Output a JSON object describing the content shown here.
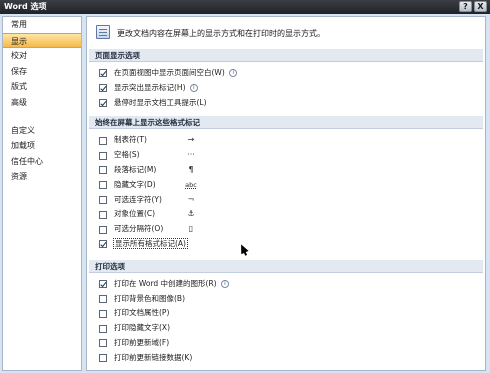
{
  "window": {
    "title": "Word 选项",
    "help_label": "?",
    "close_label": "X"
  },
  "sidebar": {
    "items": [
      {
        "label": "常用"
      },
      {
        "label": "显示",
        "active": true
      },
      {
        "label": "校对"
      },
      {
        "label": "保存"
      },
      {
        "label": "版式"
      },
      {
        "label": "高级"
      },
      {
        "label": "自定义"
      },
      {
        "label": "加载项"
      },
      {
        "label": "信任中心"
      },
      {
        "label": "资源"
      }
    ]
  },
  "header": {
    "text": "更改文档内容在屏幕上的显示方式和在打印时的显示方式。"
  },
  "sections": {
    "page_display": {
      "title": "页面显示选项",
      "options": [
        {
          "label": "在页面视图中显示页面间空白(W)",
          "checked": true
        },
        {
          "label": "显示突出显示标记(H)",
          "checked": true
        },
        {
          "label": "悬停时显示文档工具提示(L)",
          "checked": true
        }
      ]
    },
    "format_marks": {
      "title": "始终在屏幕上显示这些格式标记",
      "options": [
        {
          "label": "制表符(T)",
          "checked": false,
          "symbol": "→"
        },
        {
          "label": "空格(S)",
          "checked": false,
          "symbol": "···"
        },
        {
          "label": "段落标记(M)",
          "checked": false,
          "symbol": "¶"
        },
        {
          "label": "隐藏文字(D)",
          "checked": false,
          "symbol": "abc"
        },
        {
          "label": "可选连字符(Y)",
          "checked": false,
          "symbol": "¬"
        },
        {
          "label": "对象位置(C)",
          "checked": false,
          "symbol": "⚓"
        },
        {
          "label": "可选分隔符(O)",
          "checked": false,
          "symbol": "▯"
        },
        {
          "label": "显示所有格式标记(A)",
          "checked": true
        }
      ]
    },
    "print": {
      "title": "打印选项",
      "options": [
        {
          "label": "打印在 Word 中创建的图形(R)",
          "checked": true
        },
        {
          "label": "打印背景色和图像(B)",
          "checked": false
        },
        {
          "label": "打印文档属性(P)",
          "checked": false
        },
        {
          "label": "打印隐藏文字(X)",
          "checked": false
        },
        {
          "label": "打印前更新域(F)",
          "checked": false
        },
        {
          "label": "打印前更新链接数据(K)",
          "checked": false
        }
      ]
    }
  }
}
